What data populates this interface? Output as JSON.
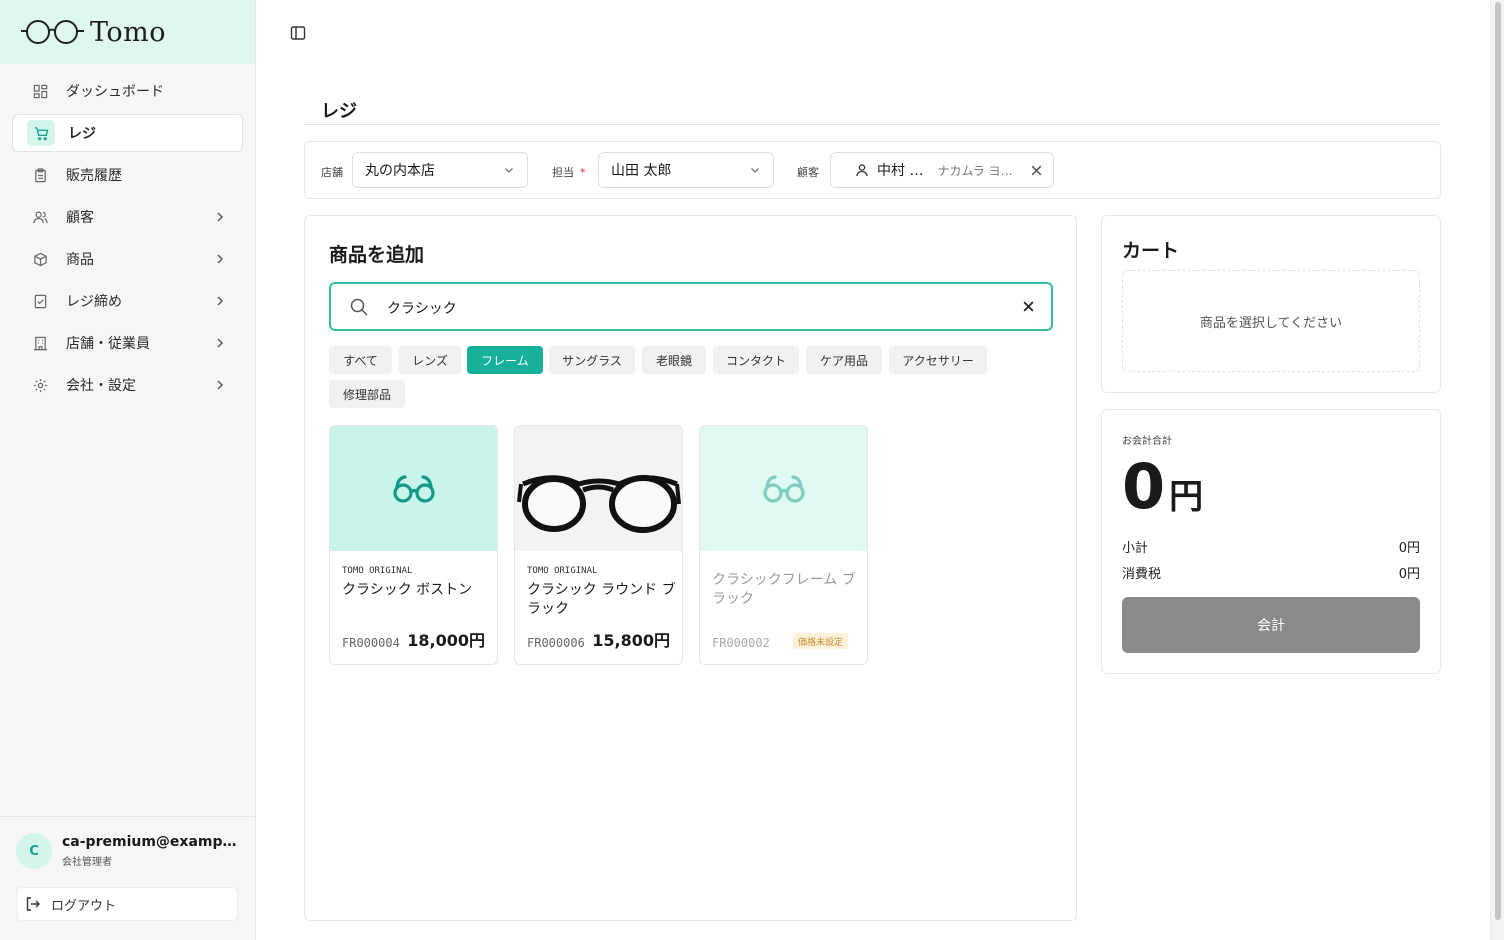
{
  "brand": {
    "name": "Tomo"
  },
  "sidebar": {
    "items": [
      {
        "label": "ダッシュボード",
        "icon": "dashboard-icon"
      },
      {
        "label": "レジ",
        "icon": "cart-icon",
        "active": true
      },
      {
        "label": "販売履歴",
        "icon": "clipboard-icon"
      },
      {
        "label": "顧客",
        "icon": "users-icon",
        "expandable": true
      },
      {
        "label": "商品",
        "icon": "package-icon",
        "expandable": true
      },
      {
        "label": "レジ締め",
        "icon": "checklist-icon",
        "expandable": true
      },
      {
        "label": "店舗・従業員",
        "icon": "building-icon",
        "expandable": true
      },
      {
        "label": "会社・設定",
        "icon": "gear-icon",
        "expandable": true
      }
    ],
    "user": {
      "initial": "C",
      "email": "ca-premium@example.com",
      "role": "会社管理者"
    },
    "logout_label": "ログアウト"
  },
  "page": {
    "title": "レジ"
  },
  "filters": {
    "store_label": "店舗",
    "store_value": "丸の内本店",
    "staff_label": "担当",
    "staff_required": "*",
    "staff_value": "山田 太郎",
    "customer_label": "顧客",
    "customer_name": "中村 …",
    "customer_kana": "ナカムラ ヨ…"
  },
  "products": {
    "title": "商品を追加",
    "search_value": "クラシック",
    "categories": [
      "すべて",
      "レンズ",
      "フレーム",
      "サングラス",
      "老眼鏡",
      "コンタクト",
      "ケア用品",
      "アクセサリー",
      "修理部品"
    ],
    "active_category": "フレーム",
    "items": [
      {
        "brand": "TOMO ORIGINAL",
        "name": "クラシック ボストン",
        "sku": "FR000004",
        "price": "18,000円"
      },
      {
        "brand": "TOMO ORIGINAL",
        "name": "クラシック ラウンド ブラック",
        "sku": "FR000006",
        "price": "15,800円"
      },
      {
        "brand": "",
        "name": "クラシックフレーム ブラック",
        "sku": "FR000002",
        "price_badge": "価格未設定"
      }
    ]
  },
  "cart": {
    "title": "カート",
    "empty_text": "商品を選択してください"
  },
  "totals": {
    "label": "お会計合計",
    "amount": "0",
    "currency": "円",
    "subtotal_label": "小計",
    "subtotal_value": "0円",
    "tax_label": "消費税",
    "tax_value": "0円",
    "checkout_label": "会計"
  },
  "colors": {
    "accent": "#17b099",
    "accent_light": "#d3f5ec",
    "brand_bg": "#dff7f0",
    "checkout_disabled": "#8a8a8a"
  }
}
